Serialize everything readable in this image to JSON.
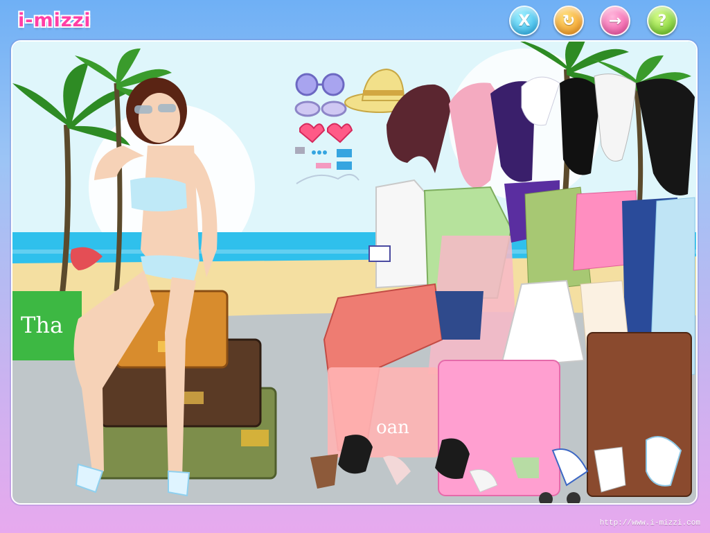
{
  "header": {
    "logo": "i-mizzi",
    "buttons": [
      {
        "id": "close",
        "icon": "close-icon",
        "glyph": "X"
      },
      {
        "id": "reset",
        "icon": "reset-icon",
        "glyph": "↻"
      },
      {
        "id": "next",
        "icon": "arrow-right-icon",
        "glyph": "→"
      },
      {
        "id": "help",
        "icon": "help-icon",
        "glyph": "?"
      }
    ]
  },
  "scene": {
    "sign_text": "Tha",
    "luggage_text": "oan"
  },
  "footer": {
    "url": "http://www.i-mizzi.com"
  },
  "colors": {
    "logo": "#ff3fa6",
    "sky": "#d8f4fb",
    "sea": "#2fc0ec",
    "sand": "#f4dfa1",
    "road": "#bfc6c9"
  }
}
